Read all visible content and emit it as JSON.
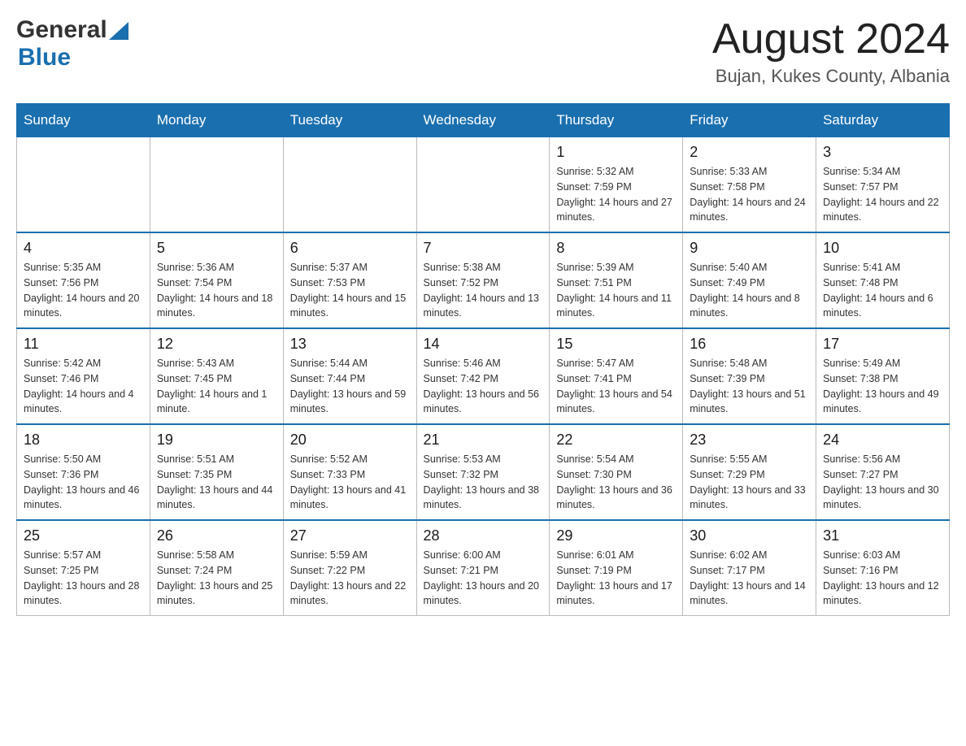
{
  "header": {
    "logo_general": "General",
    "logo_blue": "Blue",
    "month_title": "August 2024",
    "location": "Bujan, Kukes County, Albania"
  },
  "weekdays": [
    "Sunday",
    "Monday",
    "Tuesday",
    "Wednesday",
    "Thursday",
    "Friday",
    "Saturday"
  ],
  "weeks": [
    [
      {
        "day": "",
        "info": ""
      },
      {
        "day": "",
        "info": ""
      },
      {
        "day": "",
        "info": ""
      },
      {
        "day": "",
        "info": ""
      },
      {
        "day": "1",
        "info": "Sunrise: 5:32 AM\nSunset: 7:59 PM\nDaylight: 14 hours and 27 minutes."
      },
      {
        "day": "2",
        "info": "Sunrise: 5:33 AM\nSunset: 7:58 PM\nDaylight: 14 hours and 24 minutes."
      },
      {
        "day": "3",
        "info": "Sunrise: 5:34 AM\nSunset: 7:57 PM\nDaylight: 14 hours and 22 minutes."
      }
    ],
    [
      {
        "day": "4",
        "info": "Sunrise: 5:35 AM\nSunset: 7:56 PM\nDaylight: 14 hours and 20 minutes."
      },
      {
        "day": "5",
        "info": "Sunrise: 5:36 AM\nSunset: 7:54 PM\nDaylight: 14 hours and 18 minutes."
      },
      {
        "day": "6",
        "info": "Sunrise: 5:37 AM\nSunset: 7:53 PM\nDaylight: 14 hours and 15 minutes."
      },
      {
        "day": "7",
        "info": "Sunrise: 5:38 AM\nSunset: 7:52 PM\nDaylight: 14 hours and 13 minutes."
      },
      {
        "day": "8",
        "info": "Sunrise: 5:39 AM\nSunset: 7:51 PM\nDaylight: 14 hours and 11 minutes."
      },
      {
        "day": "9",
        "info": "Sunrise: 5:40 AM\nSunset: 7:49 PM\nDaylight: 14 hours and 8 minutes."
      },
      {
        "day": "10",
        "info": "Sunrise: 5:41 AM\nSunset: 7:48 PM\nDaylight: 14 hours and 6 minutes."
      }
    ],
    [
      {
        "day": "11",
        "info": "Sunrise: 5:42 AM\nSunset: 7:46 PM\nDaylight: 14 hours and 4 minutes."
      },
      {
        "day": "12",
        "info": "Sunrise: 5:43 AM\nSunset: 7:45 PM\nDaylight: 14 hours and 1 minute."
      },
      {
        "day": "13",
        "info": "Sunrise: 5:44 AM\nSunset: 7:44 PM\nDaylight: 13 hours and 59 minutes."
      },
      {
        "day": "14",
        "info": "Sunrise: 5:46 AM\nSunset: 7:42 PM\nDaylight: 13 hours and 56 minutes."
      },
      {
        "day": "15",
        "info": "Sunrise: 5:47 AM\nSunset: 7:41 PM\nDaylight: 13 hours and 54 minutes."
      },
      {
        "day": "16",
        "info": "Sunrise: 5:48 AM\nSunset: 7:39 PM\nDaylight: 13 hours and 51 minutes."
      },
      {
        "day": "17",
        "info": "Sunrise: 5:49 AM\nSunset: 7:38 PM\nDaylight: 13 hours and 49 minutes."
      }
    ],
    [
      {
        "day": "18",
        "info": "Sunrise: 5:50 AM\nSunset: 7:36 PM\nDaylight: 13 hours and 46 minutes."
      },
      {
        "day": "19",
        "info": "Sunrise: 5:51 AM\nSunset: 7:35 PM\nDaylight: 13 hours and 44 minutes."
      },
      {
        "day": "20",
        "info": "Sunrise: 5:52 AM\nSunset: 7:33 PM\nDaylight: 13 hours and 41 minutes."
      },
      {
        "day": "21",
        "info": "Sunrise: 5:53 AM\nSunset: 7:32 PM\nDaylight: 13 hours and 38 minutes."
      },
      {
        "day": "22",
        "info": "Sunrise: 5:54 AM\nSunset: 7:30 PM\nDaylight: 13 hours and 36 minutes."
      },
      {
        "day": "23",
        "info": "Sunrise: 5:55 AM\nSunset: 7:29 PM\nDaylight: 13 hours and 33 minutes."
      },
      {
        "day": "24",
        "info": "Sunrise: 5:56 AM\nSunset: 7:27 PM\nDaylight: 13 hours and 30 minutes."
      }
    ],
    [
      {
        "day": "25",
        "info": "Sunrise: 5:57 AM\nSunset: 7:25 PM\nDaylight: 13 hours and 28 minutes."
      },
      {
        "day": "26",
        "info": "Sunrise: 5:58 AM\nSunset: 7:24 PM\nDaylight: 13 hours and 25 minutes."
      },
      {
        "day": "27",
        "info": "Sunrise: 5:59 AM\nSunset: 7:22 PM\nDaylight: 13 hours and 22 minutes."
      },
      {
        "day": "28",
        "info": "Sunrise: 6:00 AM\nSunset: 7:21 PM\nDaylight: 13 hours and 20 minutes."
      },
      {
        "day": "29",
        "info": "Sunrise: 6:01 AM\nSunset: 7:19 PM\nDaylight: 13 hours and 17 minutes."
      },
      {
        "day": "30",
        "info": "Sunrise: 6:02 AM\nSunset: 7:17 PM\nDaylight: 13 hours and 14 minutes."
      },
      {
        "day": "31",
        "info": "Sunrise: 6:03 AM\nSunset: 7:16 PM\nDaylight: 13 hours and 12 minutes."
      }
    ]
  ]
}
